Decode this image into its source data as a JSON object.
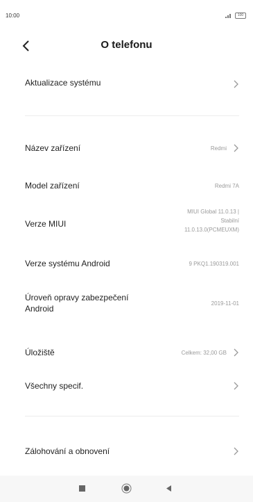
{
  "status_bar": {
    "time": "10:00",
    "battery": "100"
  },
  "header": {
    "title": "O telefonu"
  },
  "rows": {
    "system_update": {
      "label": "Aktualizace systému"
    },
    "device_name": {
      "label": "Název zařízení",
      "value": "Redmi"
    },
    "device_model": {
      "label": "Model zařízení",
      "value": "Redmi 7A"
    },
    "miui_version": {
      "label": "Verze MIUI",
      "value_lines": [
        "MIUI Global 11.0.13 |",
        "Stabilní",
        "11.0.13.0(PCMEUXM)"
      ]
    },
    "android_version": {
      "label": "Verze systému Android",
      "value": "9 PKQ1.190319.001"
    },
    "security_patch": {
      "label_lines": [
        "Úroveň opravy zabezpečení",
        "Android"
      ],
      "value": "2019-11-01"
    },
    "storage": {
      "label": "Úložiště",
      "value": "Celkem: 32,00 GB"
    },
    "all_specs": {
      "label": "Všechny specif."
    },
    "backup": {
      "label": "Zálohování a obnovení"
    }
  }
}
